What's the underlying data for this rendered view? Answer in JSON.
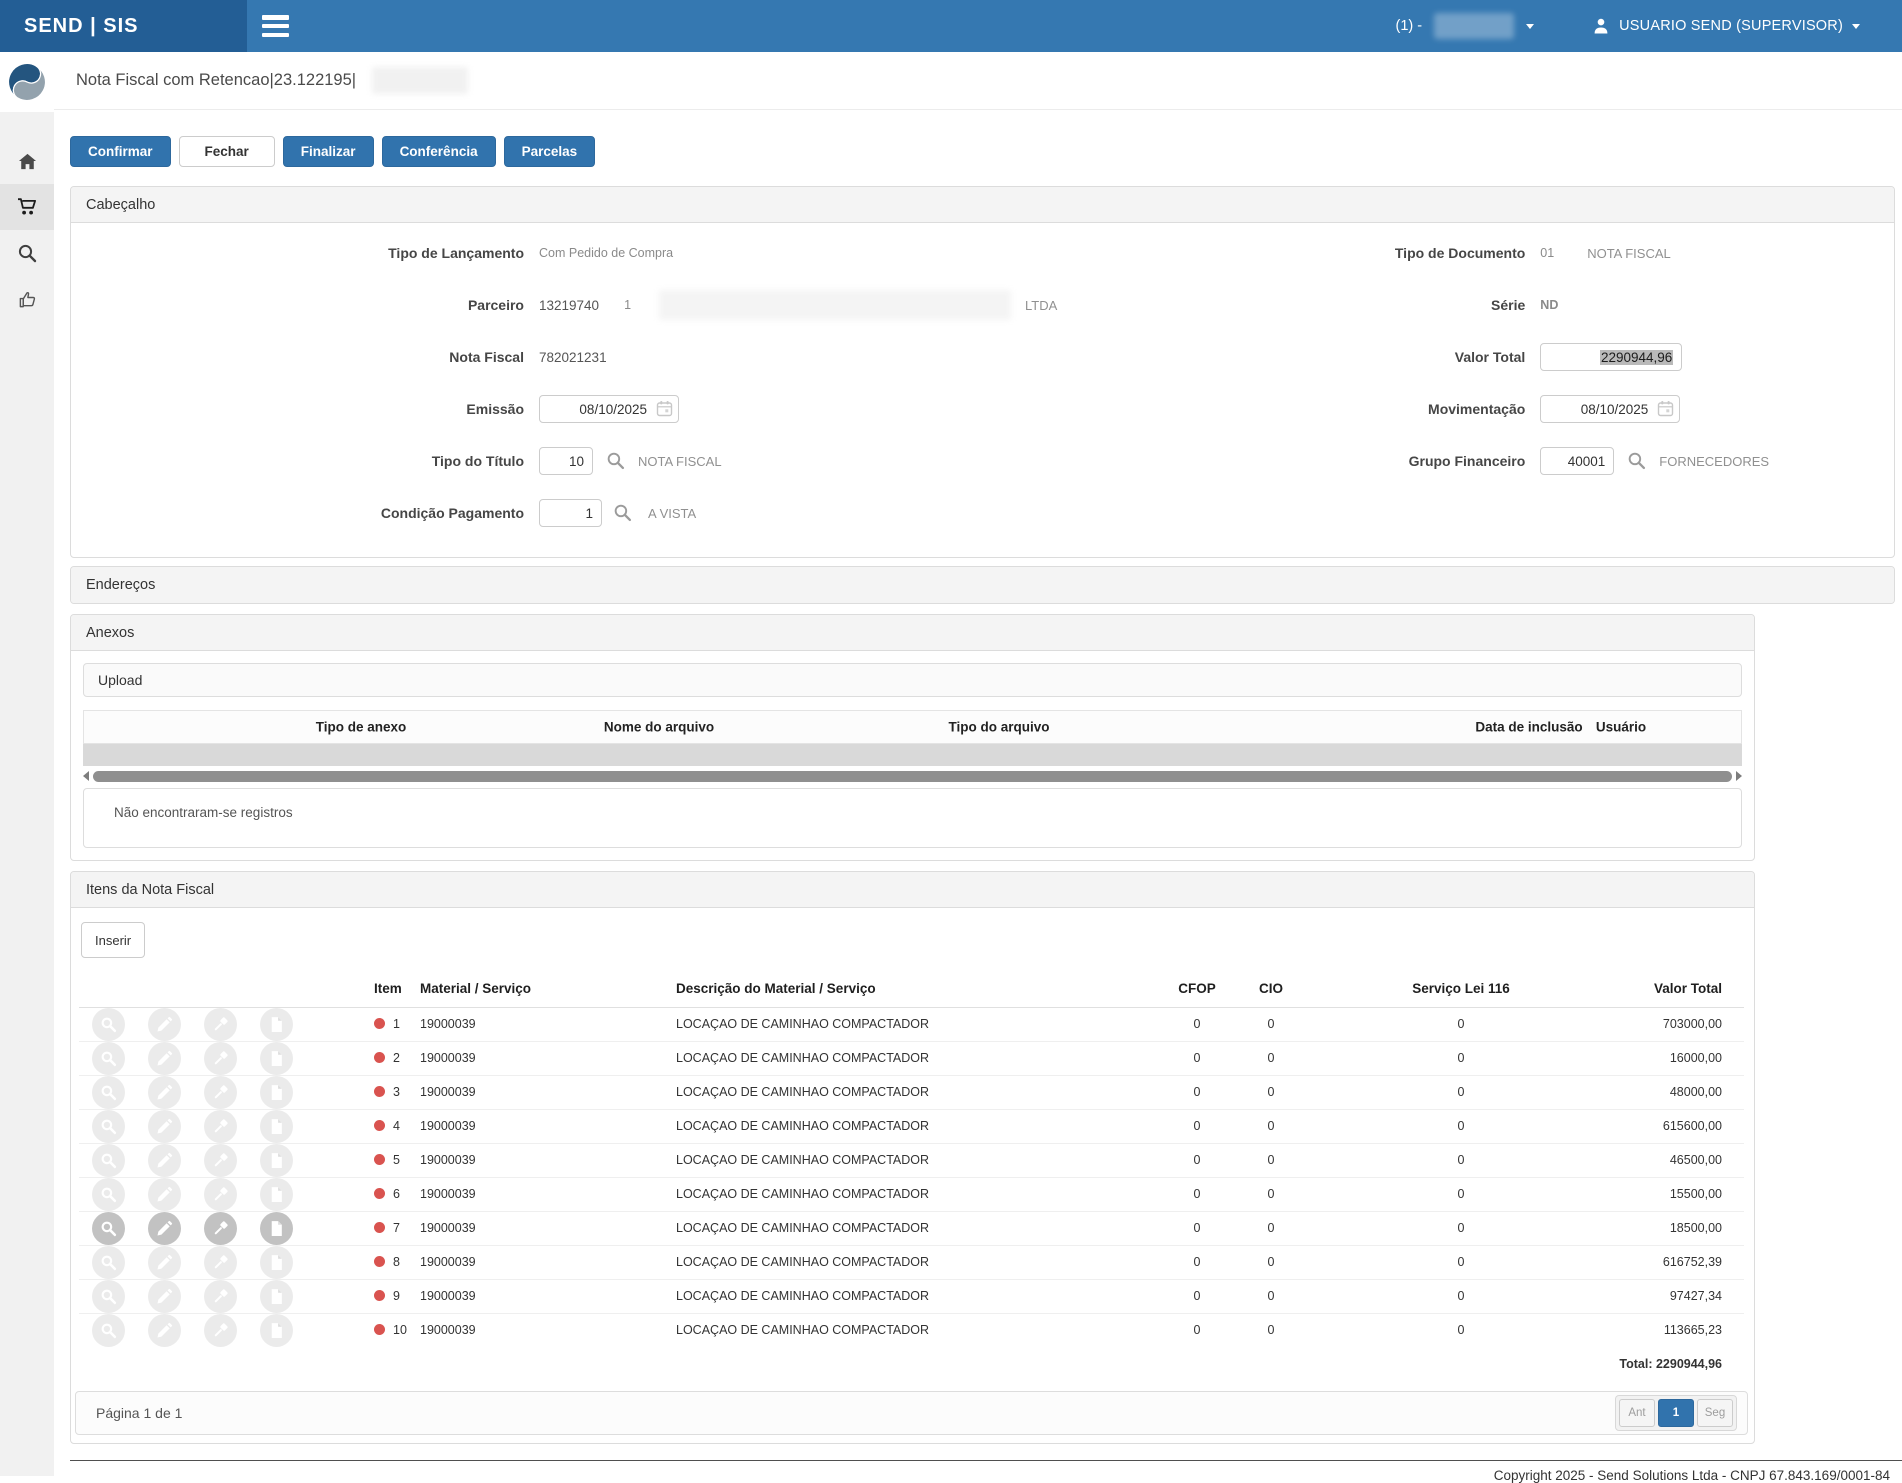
{
  "navbar": {
    "brand": "SEND | SIS",
    "env_label": "(1) -",
    "user_label": "USUARIO SEND (SUPERVISOR)"
  },
  "page": {
    "title": "Nota Fiscal com Retencao|23.122195|",
    "footer": "Copyright 2025 - Send Solutions Ltda - CNPJ 67.843.169/0001-84"
  },
  "toolbar": {
    "buttons": [
      "Confirmar",
      "Fechar",
      "Finalizar",
      "Conferência",
      "Parcelas"
    ]
  },
  "cabecalho": {
    "title": "Cabeçalho",
    "tipo_lancamento": {
      "label": "Tipo de Lançamento",
      "value": "Com Pedido de Compra"
    },
    "parceiro": {
      "label": "Parceiro",
      "code": "13219740",
      "seq": "1",
      "suffix": "LTDA"
    },
    "nota_fiscal": {
      "label": "Nota Fiscal",
      "value": "782021231"
    },
    "emissao": {
      "label": "Emissão",
      "value": "08/10/2025"
    },
    "tipo_titulo": {
      "label": "Tipo do Título",
      "code": "10",
      "desc": "NOTA FISCAL"
    },
    "condicao_pagamento": {
      "label": "Condição Pagamento",
      "code": "1",
      "desc": "A VISTA"
    },
    "tipo_documento": {
      "label": "Tipo de Documento",
      "code": "01",
      "desc": "NOTA FISCAL"
    },
    "serie": {
      "label": "Série",
      "value": "ND"
    },
    "valor_total": {
      "label": "Valor Total",
      "value": "2290944,96"
    },
    "movimentacao": {
      "label": "Movimentação",
      "value": "08/10/2025"
    },
    "grupo_financeiro": {
      "label": "Grupo Financeiro",
      "code": "40001",
      "desc": "FORNECEDORES"
    }
  },
  "enderecos": {
    "title": "Endereços"
  },
  "anexos": {
    "title": "Anexos",
    "upload_label": "Upload",
    "columns": [
      "Tipo de anexo",
      "Nome do arquivo",
      "Tipo do arquivo",
      "Data de inclusão",
      "Usuário"
    ],
    "empty_message": "Não encontraram-se registros"
  },
  "itens": {
    "title": "Itens da Nota Fiscal",
    "insert_label": "Inserir",
    "columns": [
      "Item",
      "Material / Serviço",
      "Descrição do Material / Serviço",
      "CFOP",
      "CIO",
      "Serviço Lei 116",
      "Valor Total"
    ],
    "rows": [
      {
        "item": "1",
        "material": "19000039",
        "descricao": "LOCAÇAO DE CAMINHAO COMPACTADOR",
        "cfop": "0",
        "cio": "0",
        "servico_lei": "0",
        "valor": "703000,00",
        "highlighted": false
      },
      {
        "item": "2",
        "material": "19000039",
        "descricao": "LOCAÇAO DE CAMINHAO COMPACTADOR",
        "cfop": "0",
        "cio": "0",
        "servico_lei": "0",
        "valor": "16000,00",
        "highlighted": false
      },
      {
        "item": "3",
        "material": "19000039",
        "descricao": "LOCAÇAO DE CAMINHAO COMPACTADOR",
        "cfop": "0",
        "cio": "0",
        "servico_lei": "0",
        "valor": "48000,00",
        "highlighted": false
      },
      {
        "item": "4",
        "material": "19000039",
        "descricao": "LOCAÇAO DE CAMINHAO COMPACTADOR",
        "cfop": "0",
        "cio": "0",
        "servico_lei": "0",
        "valor": "615600,00",
        "highlighted": false
      },
      {
        "item": "5",
        "material": "19000039",
        "descricao": "LOCAÇAO DE CAMINHAO COMPACTADOR",
        "cfop": "0",
        "cio": "0",
        "servico_lei": "0",
        "valor": "46500,00",
        "highlighted": false
      },
      {
        "item": "6",
        "material": "19000039",
        "descricao": "LOCAÇAO DE CAMINHAO COMPACTADOR",
        "cfop": "0",
        "cio": "0",
        "servico_lei": "0",
        "valor": "15500,00",
        "highlighted": false
      },
      {
        "item": "7",
        "material": "19000039",
        "descricao": "LOCAÇAO DE CAMINHAO COMPACTADOR",
        "cfop": "0",
        "cio": "0",
        "servico_lei": "0",
        "valor": "18500,00",
        "highlighted": true
      },
      {
        "item": "8",
        "material": "19000039",
        "descricao": "LOCAÇAO DE CAMINHAO COMPACTADOR",
        "cfop": "0",
        "cio": "0",
        "servico_lei": "0",
        "valor": "616752,39",
        "highlighted": false
      },
      {
        "item": "9",
        "material": "19000039",
        "descricao": "LOCAÇAO DE CAMINHAO COMPACTADOR",
        "cfop": "0",
        "cio": "0",
        "servico_lei": "0",
        "valor": "97427,34",
        "highlighted": false
      },
      {
        "item": "10",
        "material": "19000039",
        "descricao": "LOCAÇAO DE CAMINHAO COMPACTADOR",
        "cfop": "0",
        "cio": "0",
        "servico_lei": "0",
        "valor": "113665,23",
        "highlighted": false
      }
    ],
    "total_label": "Total: 2290944,96",
    "pagination": {
      "info": "Página 1 de 1",
      "prev": "Ant",
      "current": "1",
      "next": "Seg"
    }
  },
  "colors": {
    "navbar": "#3578b1",
    "navbar_brand": "#235e95",
    "primary_button": "#3173ad",
    "status_dot": "#d9534f",
    "selection_highlight": "#b9b9b9"
  }
}
